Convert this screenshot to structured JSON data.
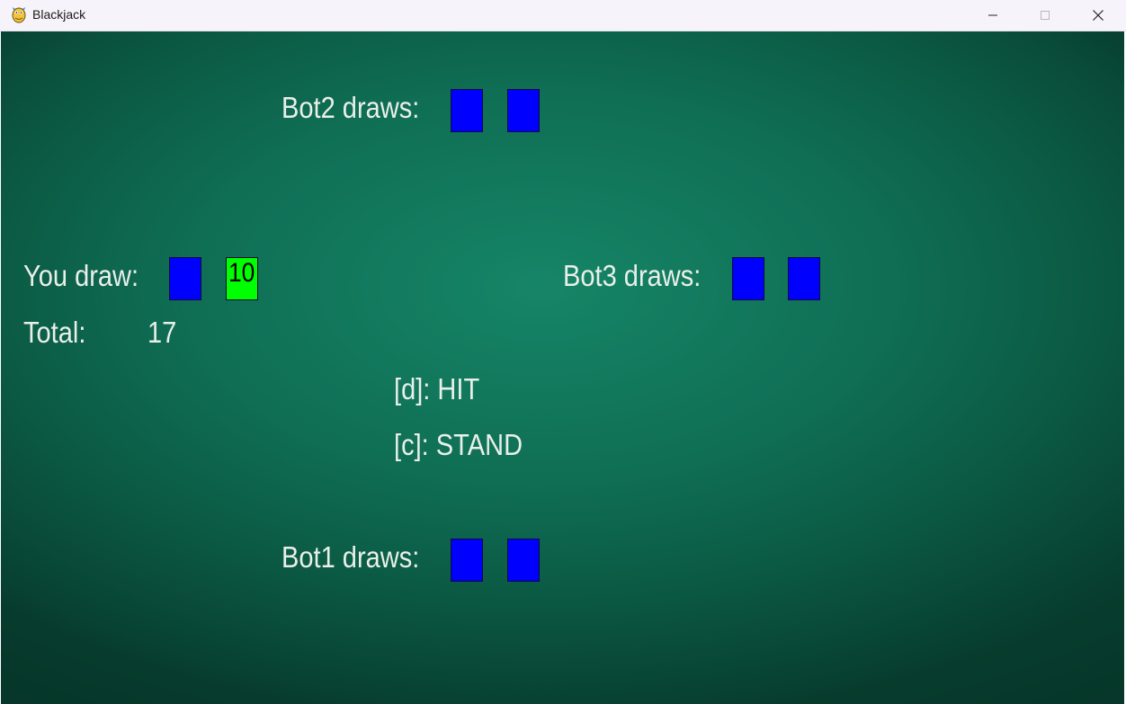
{
  "window": {
    "title": "Blackjack",
    "icon": "pygame-snake-icon",
    "controls": [
      "minimize-icon",
      "maximize-icon",
      "close-icon"
    ]
  },
  "table": {
    "background_color": "#0f6e54",
    "card_back_color": "#0000ff",
    "card_face_color": "#00ff00"
  },
  "bot2": {
    "label": "Bot2 draws:",
    "cards": [
      "hidden",
      "hidden"
    ]
  },
  "player": {
    "label": "You draw:",
    "cards": [
      "hidden",
      "10"
    ],
    "visible_card": "10",
    "total_label": "Total:",
    "total_value": "17"
  },
  "bot3": {
    "label": "Bot3 draws:",
    "cards": [
      "hidden",
      "hidden"
    ]
  },
  "controls": {
    "hit": "[d]: HIT",
    "stand": "[c]: STAND"
  },
  "bot1": {
    "label": "Bot1 draws:",
    "cards": [
      "hidden",
      "hidden"
    ]
  }
}
